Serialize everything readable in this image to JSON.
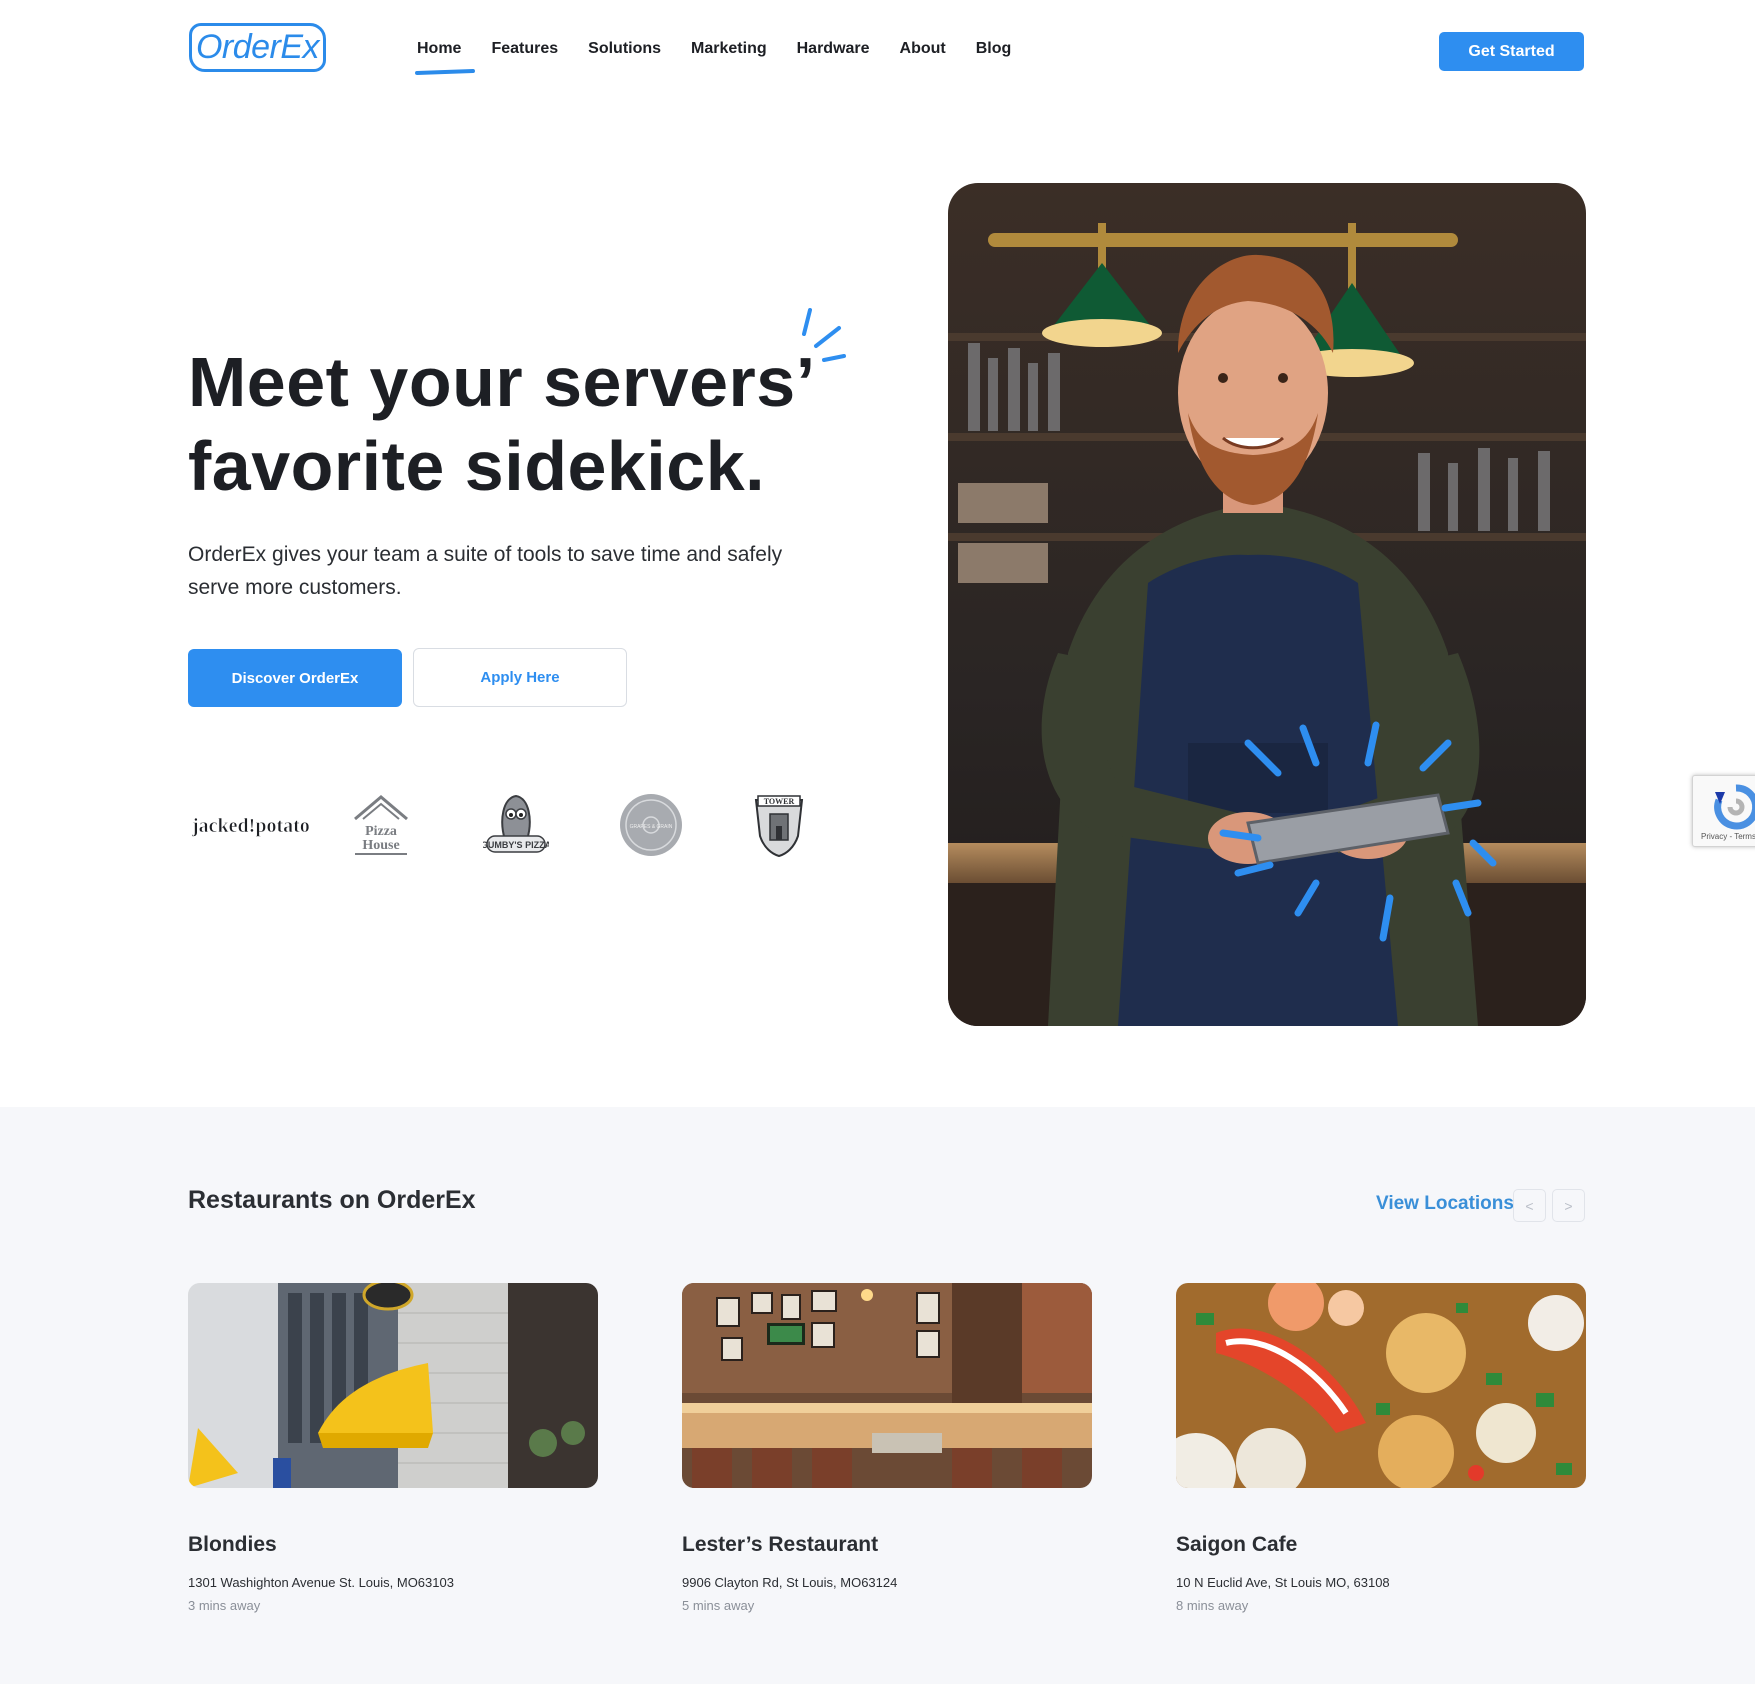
{
  "brand": {
    "logo_text": "OrderEx"
  },
  "nav": {
    "items": [
      {
        "label": "Home",
        "active": true
      },
      {
        "label": "Features",
        "active": false
      },
      {
        "label": "Solutions",
        "active": false
      },
      {
        "label": "Marketing",
        "active": false
      },
      {
        "label": "Hardware",
        "active": false
      },
      {
        "label": "About",
        "active": false
      },
      {
        "label": "Blog",
        "active": false
      }
    ],
    "cta_label": "Get Started"
  },
  "hero": {
    "title_line1": "Meet your servers’",
    "title_line2": "favorite sidekick.",
    "subtitle": "OrderEx gives your team a suite of tools to save time and safely serve more customers.",
    "primary_button": "Discover OrderEx",
    "secondary_button": "Apply Here",
    "partner_logos": [
      {
        "name": "jacked-potato-logo",
        "text": "jacked!potato"
      },
      {
        "name": "pizza-house-logo",
        "text_line1": "Pizza",
        "text_line2": "House"
      },
      {
        "name": "gumbys-pizza-logo",
        "text": "GUMBY'S PIZZA"
      },
      {
        "name": "grapes-and-grain-logo",
        "text": "GRAPES & GRAIN"
      },
      {
        "name": "tower-tap-logo",
        "text": "TOWER"
      }
    ]
  },
  "restaurants": {
    "section_title": "Restaurants on OrderEx",
    "view_link": "View Locations",
    "prev_label": "<",
    "next_label": ">",
    "items": [
      {
        "name": "Blondies",
        "address": "1301 Washighton Avenue St. Louis, MO63103",
        "distance": "3 mins away"
      },
      {
        "name": "Lester’s Restaurant",
        "address": "9906 Clayton Rd, St Louis, MO63124",
        "distance": "5 mins away"
      },
      {
        "name": "Saigon Cafe",
        "address": "10 N Euclid Ave, St Louis MO, 63108",
        "distance": "8 mins away"
      }
    ]
  },
  "recaptcha": {
    "text": "Privacy - Terms"
  },
  "colors": {
    "accent": "#2e8ef0",
    "text": "#1d1f24",
    "section_bg": "#f6f7fa"
  }
}
